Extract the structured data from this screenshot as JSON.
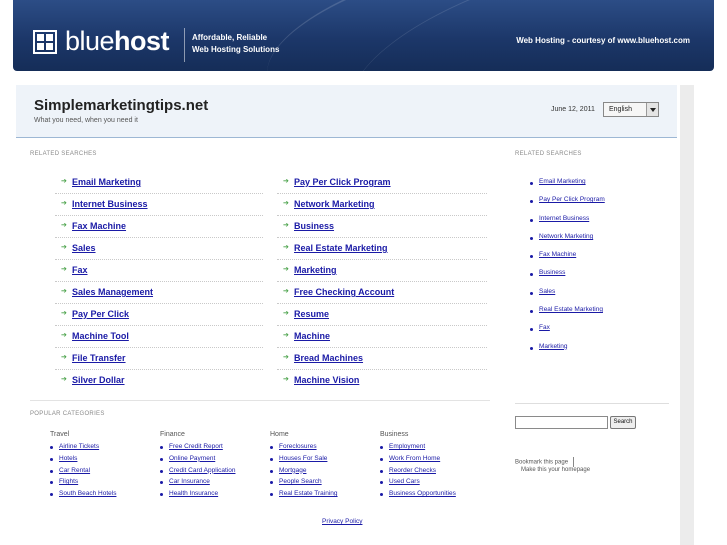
{
  "host_header": {
    "logo_light": "blue",
    "logo_bold": "host",
    "tagline_line1": "Affordable, Reliable",
    "tagline_line2": "Web Hosting Solutions",
    "courtesy": "Web Hosting - courtesy of www.bluehost.com"
  },
  "site": {
    "title": "Simplemarketingtips.net",
    "subtitle": "What you need, when you need it",
    "date": "June 12, 2011",
    "language": "English"
  },
  "related_label": "RELATED SEARCHES",
  "related_searches": [
    [
      "Email Marketing",
      "Pay Per Click Program"
    ],
    [
      "Internet Business",
      "Network Marketing"
    ],
    [
      "Fax Machine",
      "Business"
    ],
    [
      "Sales",
      "Real Estate Marketing"
    ],
    [
      "Fax",
      "Marketing"
    ],
    [
      "Sales Management",
      "Free Checking Account"
    ],
    [
      "Pay Per Click",
      "Resume"
    ],
    [
      "Machine Tool",
      "Machine"
    ],
    [
      "File Transfer",
      "Bread Machines"
    ],
    [
      "Silver Dollar",
      "Machine Vision"
    ]
  ],
  "sidebar": {
    "label": "RELATED SEARCHES",
    "items": [
      "Email Marketing",
      "Pay Per Click Program",
      "Internet Business",
      "Network Marketing",
      "Fax Machine",
      "Business",
      "Sales",
      "Real Estate Marketing",
      "Fax",
      "Marketing"
    ],
    "search_button": "Search",
    "bookmark": "Bookmark this page",
    "homepage": "Make this your homepage"
  },
  "popular": {
    "label": "POPULAR CATEGORIES",
    "categories": [
      {
        "name": "Travel",
        "items": [
          "Airline Tickets",
          "Hotels",
          "Car Rental",
          "Flights",
          "South Beach Hotels"
        ]
      },
      {
        "name": "Finance",
        "items": [
          "Free Credit Report",
          "Online Payment",
          "Credit Card Application",
          "Car Insurance",
          "Health Insurance"
        ]
      },
      {
        "name": "Home",
        "items": [
          "Foreclosures",
          "Houses For Sale",
          "Mortgage",
          "People Search",
          "Real Estate Training"
        ]
      },
      {
        "name": "Business",
        "items": [
          "Employment",
          "Work From Home",
          "Reorder Checks",
          "Used Cars",
          "Business Opportunities"
        ]
      }
    ]
  },
  "footer": {
    "privacy": "Privacy Policy"
  }
}
